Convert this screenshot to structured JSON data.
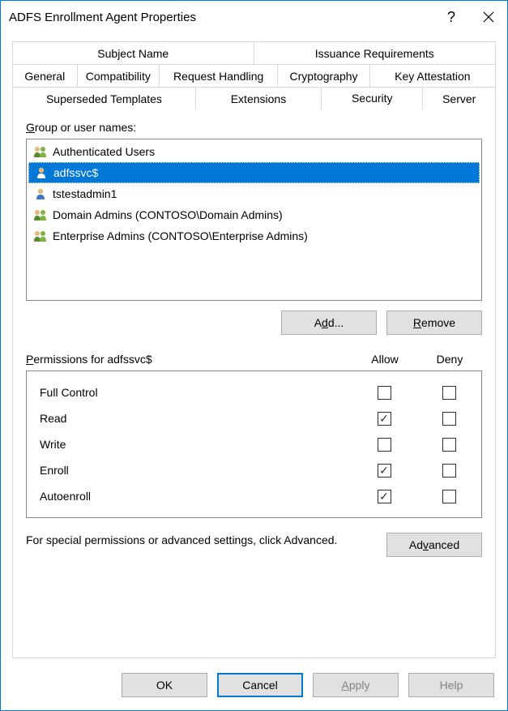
{
  "title": "ADFS Enrollment Agent Properties",
  "tabs_row1": [
    "Subject Name",
    "Issuance Requirements"
  ],
  "tabs_row2": [
    "General",
    "Compatibility",
    "Request Handling",
    "Cryptography",
    "Key Attestation"
  ],
  "tabs_row3": [
    "Superseded Templates",
    "Extensions",
    "Security",
    "Server"
  ],
  "active_tab": "Security",
  "group_label_prefix": "G",
  "group_label": "roup or user names:",
  "users": [
    {
      "name": "Authenticated Users",
      "type": "group",
      "selected": false
    },
    {
      "name": "adfssvc$",
      "type": "user",
      "selected": true
    },
    {
      "name": "tstestadmin1",
      "type": "user",
      "selected": false
    },
    {
      "name": "Domain Admins (CONTOSO\\Domain Admins)",
      "type": "group",
      "selected": false
    },
    {
      "name": "Enterprise Admins (CONTOSO\\Enterprise Admins)",
      "type": "group",
      "selected": false
    }
  ],
  "add_btn_prefix": "A",
  "add_btn_u": "d",
  "add_btn_suffix": "d...",
  "remove_btn_u": "R",
  "remove_btn_suffix": "emove",
  "perm_label_u": "P",
  "perm_label": "ermissions for adfssvc$",
  "allow_label": "Allow",
  "deny_label": "Deny",
  "permissions": [
    {
      "name": "Full Control",
      "allow": false,
      "deny": false
    },
    {
      "name": "Read",
      "allow": true,
      "deny": false
    },
    {
      "name": "Write",
      "allow": false,
      "deny": false
    },
    {
      "name": "Enroll",
      "allow": true,
      "deny": false
    },
    {
      "name": "Autoenroll",
      "allow": true,
      "deny": false
    }
  ],
  "advanced_text": "For special permissions or advanced settings, click Advanced.",
  "advanced_btn_prefix": "Ad",
  "advanced_btn_u": "v",
  "advanced_btn_suffix": "anced",
  "ok_btn": "OK",
  "cancel_btn": "Cancel",
  "apply_btn_u": "A",
  "apply_btn_suffix": "pply",
  "help_btn": "Help"
}
